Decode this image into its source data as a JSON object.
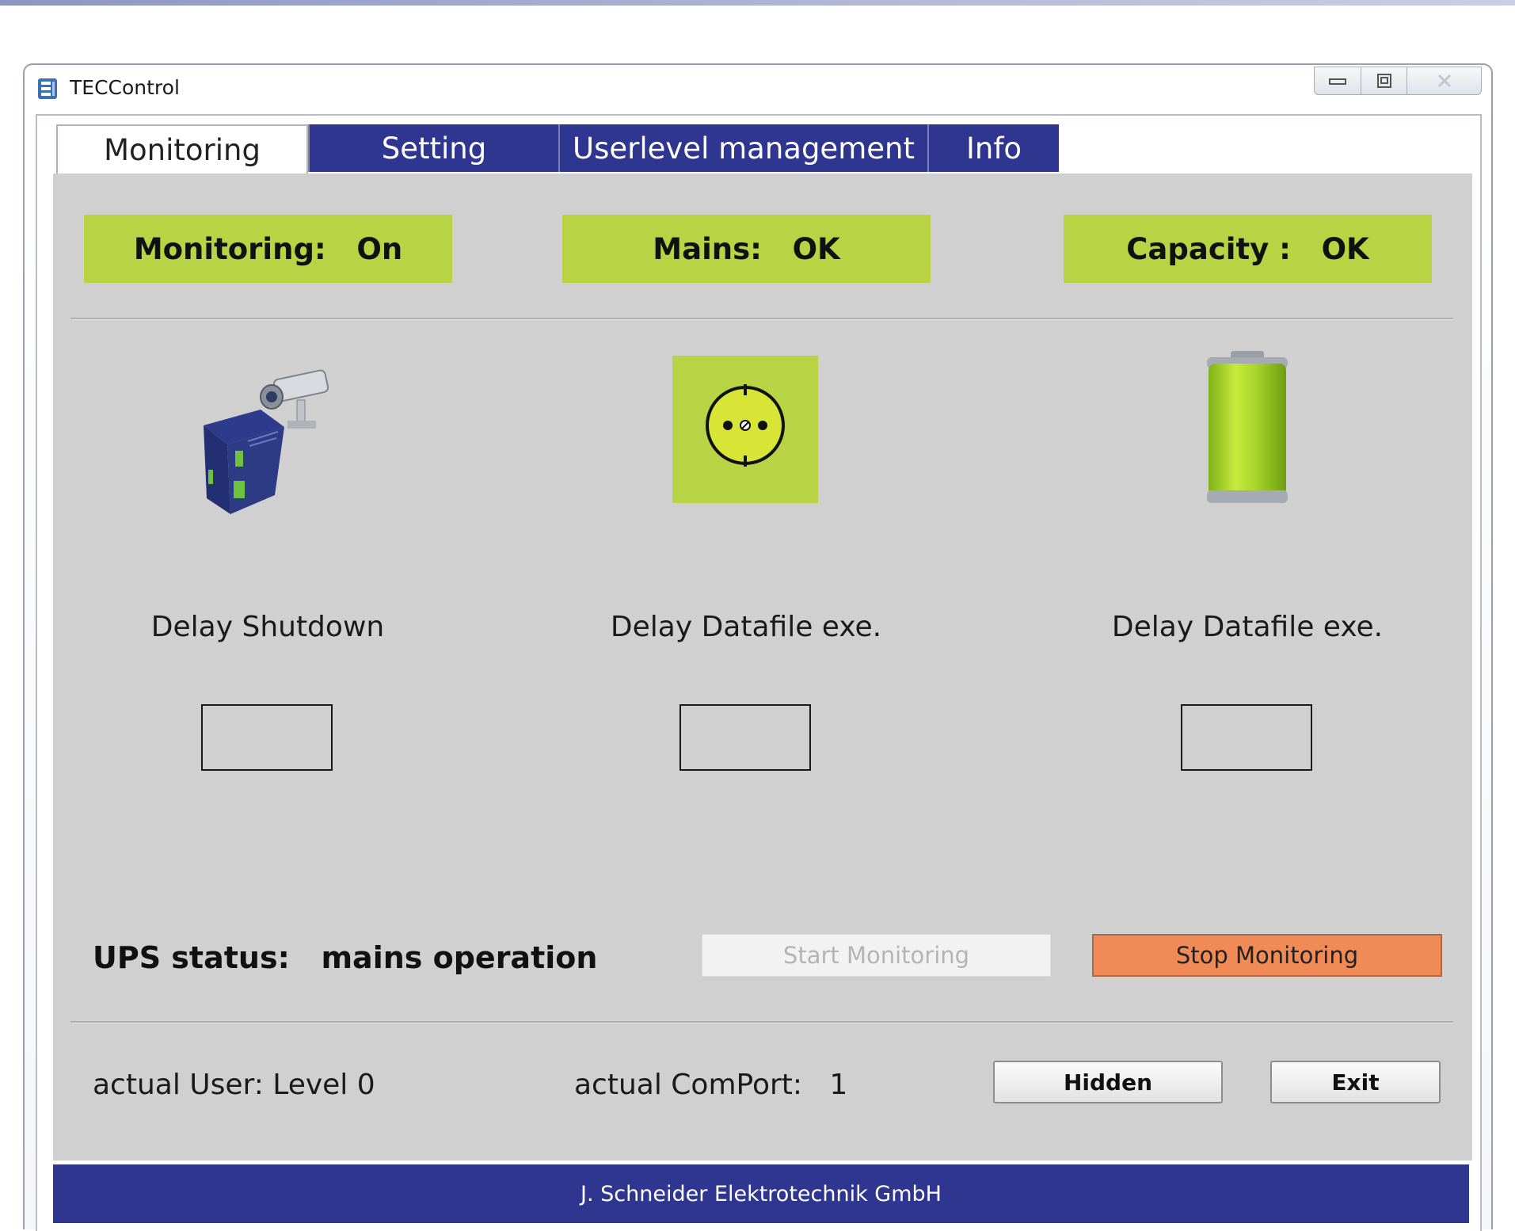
{
  "window": {
    "title": "TECControl",
    "app_icon": "app-icon",
    "caption_buttons": [
      "minimize-icon",
      "restore-icon",
      "close-icon"
    ]
  },
  "tabs": [
    {
      "label": "Monitoring",
      "active": true
    },
    {
      "label": "Setting",
      "active": false
    },
    {
      "label": "Userlevel management",
      "active": false
    },
    {
      "label": "Info",
      "active": false
    }
  ],
  "status": {
    "monitoring": "Monitoring:   On",
    "mains": "Mains:   OK",
    "capacity": "Capacity :   OK"
  },
  "panels": [
    {
      "icon": "device-camera-icon",
      "delay_label": "Delay Shutdown",
      "delay_value": ""
    },
    {
      "icon": "power-socket-icon",
      "delay_label": "Delay Datafile exe.",
      "delay_value": ""
    },
    {
      "icon": "battery-icon",
      "delay_label": "Delay Datafile exe.",
      "delay_value": ""
    }
  ],
  "ups_status": "UPS status:   mains operation",
  "buttons": {
    "start": "Start Monitoring",
    "stop": "Stop Monitoring",
    "hidden": "Hidden",
    "exit": "Exit"
  },
  "info": {
    "user": "actual User: Level 0",
    "comport": "actual ComPort:   1"
  },
  "footer": "J. Schneider Elektrotechnik GmbH",
  "colors": {
    "tab_blue": "#2e3690",
    "status_green": "#b8d444",
    "stop_orange": "#f08a56",
    "panel_gray": "#d0d0d0"
  }
}
